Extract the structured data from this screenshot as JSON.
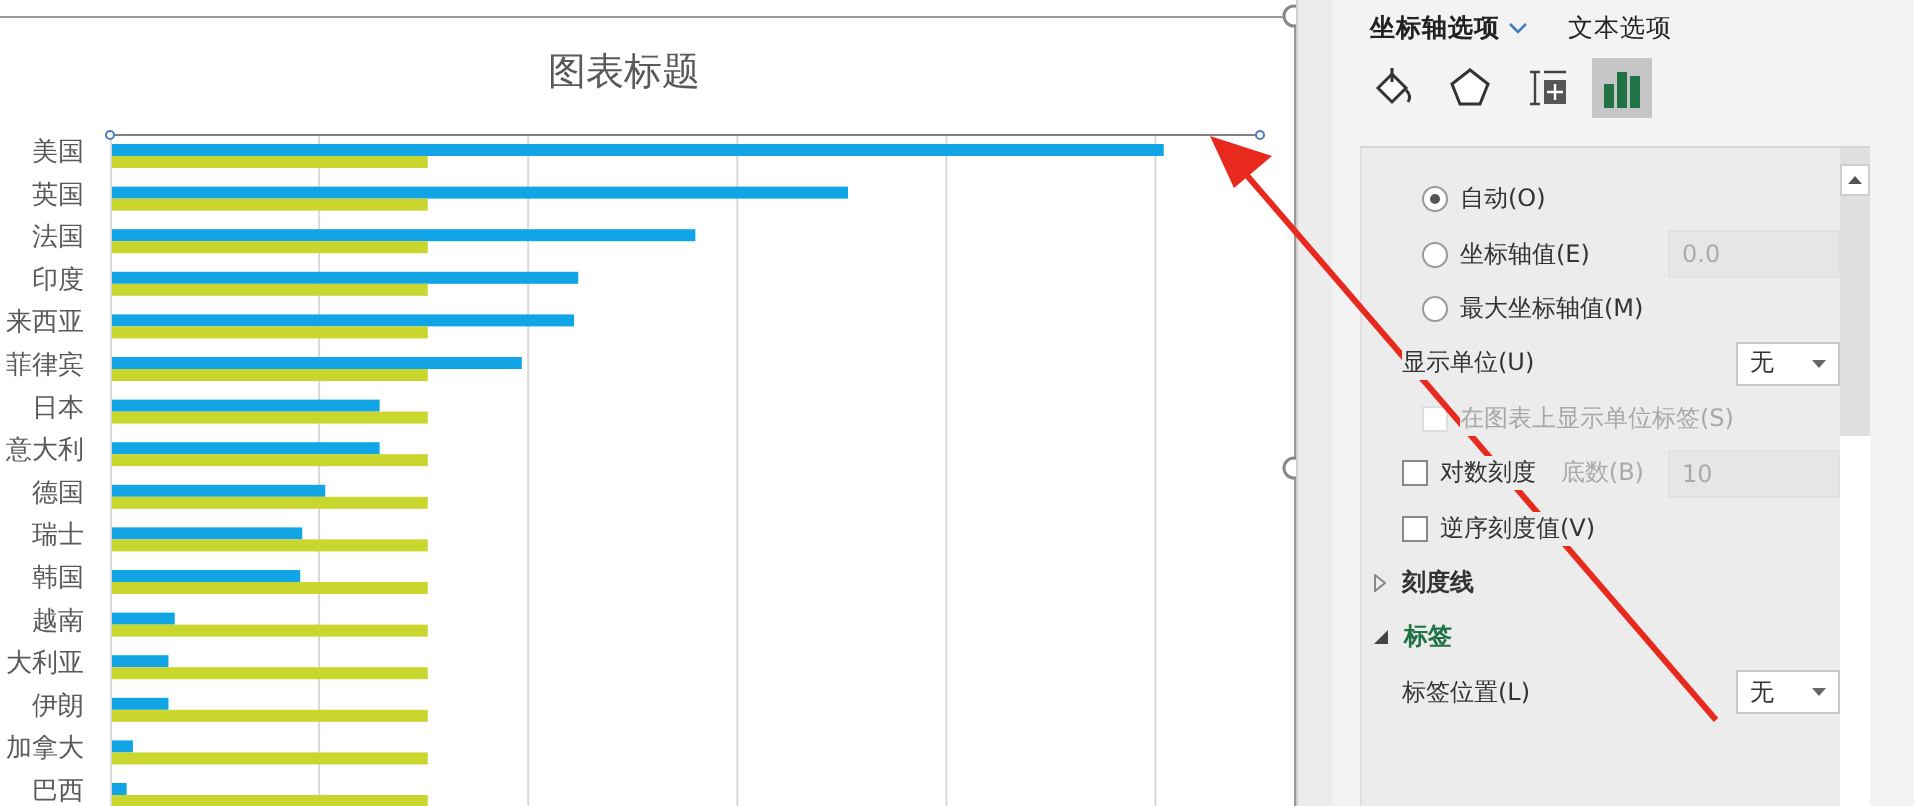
{
  "chart": {
    "title": "图表标题",
    "categories": [
      "美国",
      "英国",
      "法国",
      "印度",
      "来西亚",
      "菲律宾",
      "日本",
      "意大利",
      "德国",
      "瑞士",
      "韩国",
      "越南",
      "大利亚",
      "伊朗",
      "加拿大",
      "巴西"
    ]
  },
  "panel": {
    "tabs": [
      {
        "label": "坐标轴选项",
        "selected": true
      },
      {
        "label": "文本选项",
        "selected": false
      }
    ],
    "icon_tabs": [
      {
        "kind": "fill",
        "selected": false
      },
      {
        "kind": "effects",
        "selected": false
      },
      {
        "kind": "size",
        "selected": false
      },
      {
        "kind": "options",
        "selected": true
      }
    ],
    "rows": [
      {
        "kind": "radio",
        "label": "自动(O)",
        "selected": true
      },
      {
        "kind": "radio",
        "label": "坐标轴值(E)",
        "selected": false,
        "value": "0.0"
      },
      {
        "kind": "radio",
        "label": "最大坐标轴值(M)",
        "selected": false
      },
      {
        "kind": "select",
        "label": "显示单位(U)",
        "value": "无"
      },
      {
        "kind": "checkbox",
        "label": "在图表上显示单位标签(S)",
        "checked": false,
        "disabled": true
      },
      {
        "kind": "checkbox",
        "label": "对数刻度",
        "checked": false,
        "disabled": false,
        "field_label": "底数(B)",
        "value": "10"
      },
      {
        "kind": "checkbox",
        "label": "逆序刻度值(V)",
        "checked": false,
        "disabled": false
      },
      {
        "kind": "section",
        "label": "刻度线",
        "expanded": false
      },
      {
        "kind": "section",
        "label": "标签",
        "expanded": true
      },
      {
        "kind": "select",
        "label": "标签位置(L)",
        "value": "无"
      }
    ]
  }
}
